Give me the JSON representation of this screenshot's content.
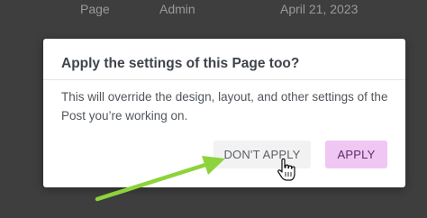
{
  "background_table": {
    "row": {
      "type": "Page",
      "author": "Admin",
      "date": "April 21, 2023"
    }
  },
  "dialog": {
    "title": "Apply the settings of this Page too?",
    "body": "This will override the design, layout, and other settings of the Post you’re working on.",
    "buttons": {
      "dont_apply_label": "DON'T APPLY",
      "apply_label": "APPLY"
    }
  },
  "colors": {
    "overlay_bg": "#3e3e3e",
    "dialog_bg": "#ffffff",
    "apply_button_bg": "#f0c6f3",
    "dont_apply_button_bg": "#f2f2f2",
    "annotation_arrow": "#8dd33b"
  },
  "icons": {
    "cursor": "hand-pointer-icon",
    "annotation": "green-arrow-icon"
  }
}
